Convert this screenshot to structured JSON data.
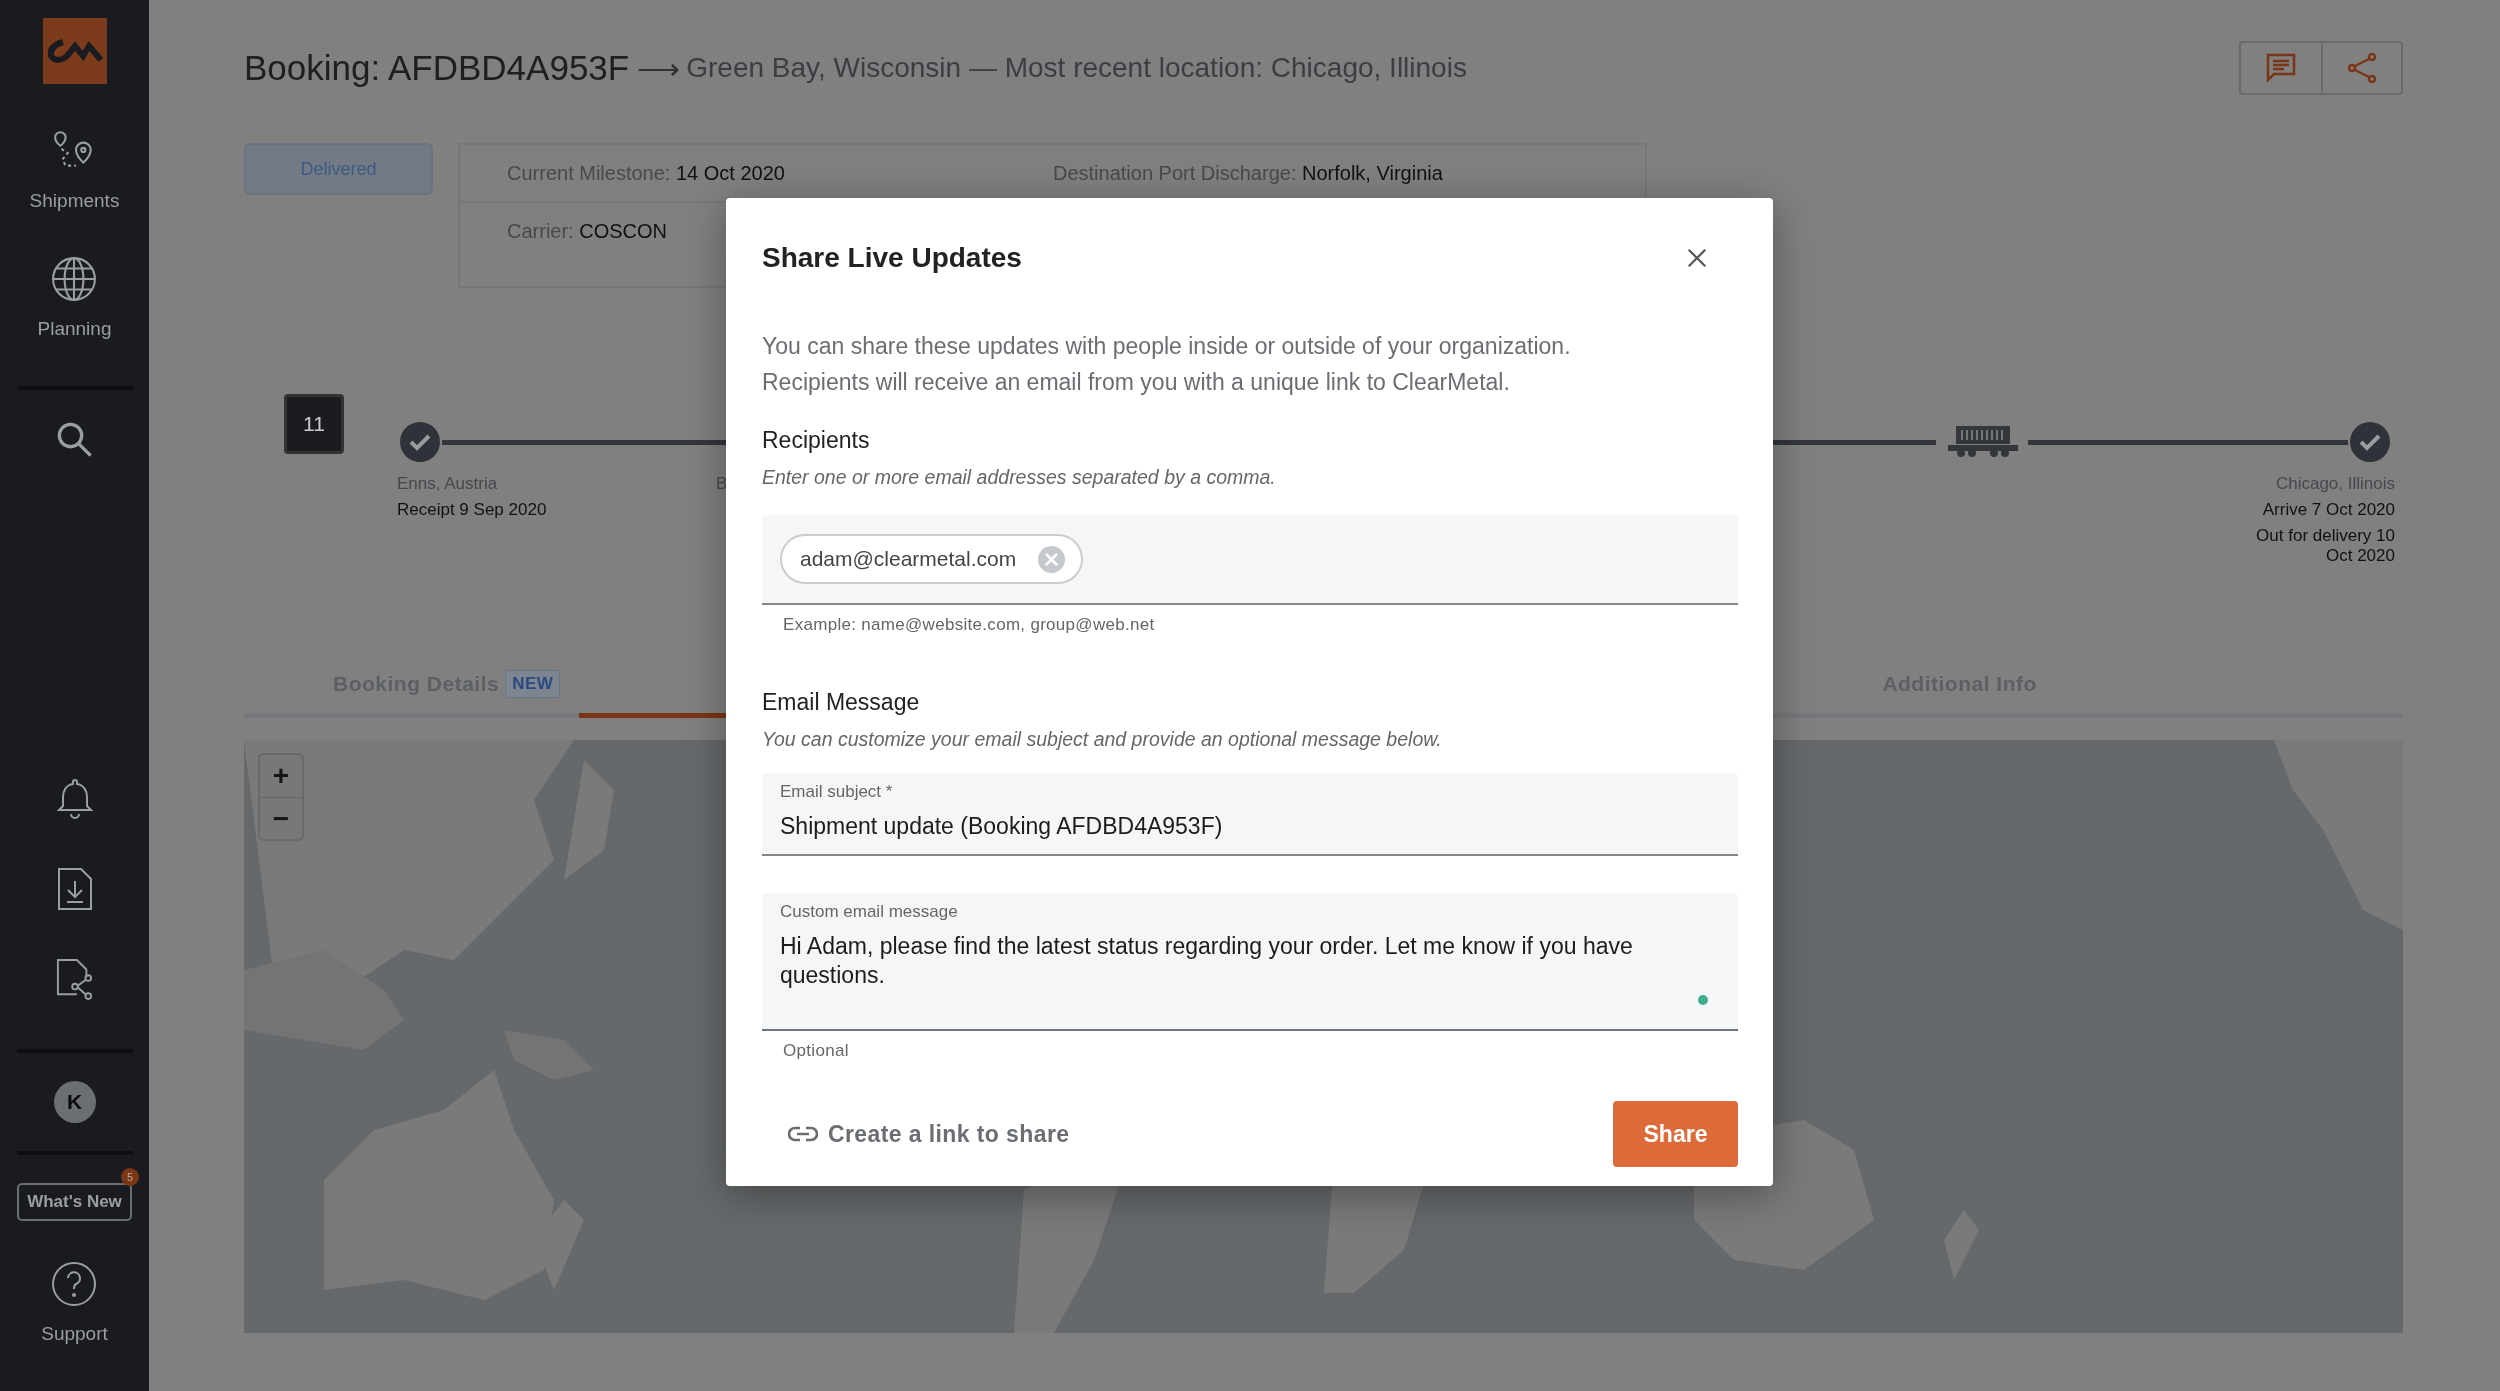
{
  "sidebar": {
    "nav": [
      {
        "label": "Shipments"
      },
      {
        "label": "Planning"
      }
    ],
    "avatar": "K",
    "whats_new": {
      "label": "What's New",
      "badge": "5"
    },
    "support": {
      "label": "Support"
    }
  },
  "header": {
    "title": "Booking: AFDBD4A953F",
    "arrow": "⟶",
    "route": "Green Bay, Wisconsin — Most recent location: Chicago, Illinois"
  },
  "status": "Delivered",
  "info": [
    {
      "label": "Current Milestone:",
      "value": "14 Oct 2020"
    },
    {
      "label": "Destination Port Discharge:",
      "value": "Norfolk, Virginia"
    },
    {
      "label": "Carrier:",
      "value": "COSCON"
    }
  ],
  "timeline": {
    "day_badge": "11",
    "start": {
      "place": "Enns, Austria",
      "events": [
        "Receipt 9 Sep 2020"
      ],
      "done": true
    },
    "partial_label": "B",
    "end": {
      "place": "Chicago, Illinois",
      "events": [
        "Arrive 7 Oct 2020",
        "Out for delivery 10 Oct 2020"
      ],
      "done": true
    }
  },
  "tabs": [
    {
      "label": "Booking Details",
      "badge": "NEW",
      "selected": false
    },
    {
      "label": "Additional Info",
      "selected": false
    }
  ],
  "map": {
    "kind": "picture",
    "zoom_in": "+",
    "zoom_out": "−"
  },
  "modal": {
    "title": "Share Live Updates",
    "description": "You can share these updates with people inside or outside of your organization. Recipients will receive an email from you with a unique link to ClearMetal.",
    "recipients": {
      "label": "Recipients",
      "hint": "Enter one or more email addresses separated by a comma.",
      "chips": [
        "adam@clearmetal.com"
      ],
      "example": "Example: name@website.com, group@web.net"
    },
    "message": {
      "label": "Email Message",
      "hint": "You can customize your email subject and provide an optional message below.",
      "subject": {
        "label": "Email subject *",
        "value": "Shipment update (Booking AFDBD4A953F)"
      },
      "custom": {
        "label": "Custom email message",
        "value": "Hi Adam, please find the latest status regarding your order. Let me know if you have questions.",
        "helper": "Optional"
      }
    },
    "link": "Create a link to share",
    "share": "Share"
  }
}
